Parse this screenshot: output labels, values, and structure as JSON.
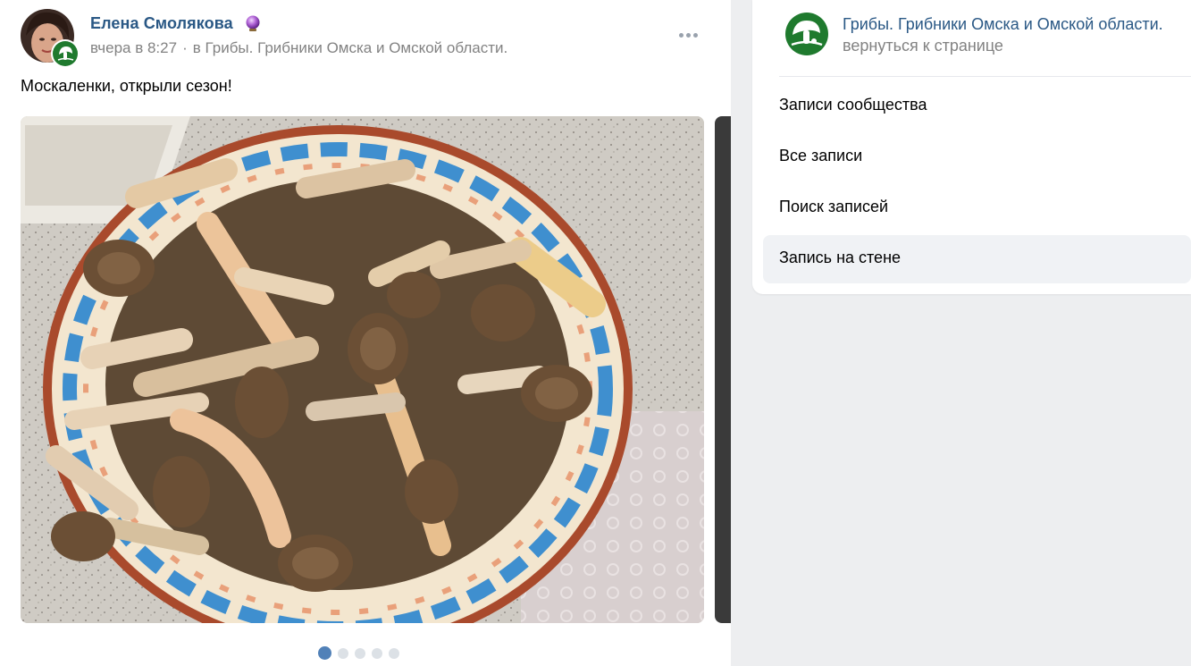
{
  "post": {
    "author": "Елена Смолякова",
    "time": "вчера в 8:27",
    "separator": "·",
    "group_ref": "в Грибы. Грибники Омска и Омской области.",
    "text": "Москаленки, открыли сезон!",
    "photo_count": 5,
    "current_photo": 1
  },
  "panel": {
    "title": "Грибы. Грибники Омска и Омской области.",
    "back_link": "вернуться к странице",
    "menu": [
      {
        "label": "Записи сообщества"
      },
      {
        "label": "Все записи"
      },
      {
        "label": "Поиск записей"
      },
      {
        "label": "Запись на стене"
      }
    ]
  },
  "colors": {
    "link": "#2a5885",
    "muted": "#828282",
    "accent": "#5181b8",
    "page_bg": "#edeef0",
    "group_green": "#1f7a2e"
  },
  "icons": {
    "more": "more-horizontal-icon",
    "badge": "purple-orb-icon",
    "group_logo": "mushroom-logo-icon"
  }
}
